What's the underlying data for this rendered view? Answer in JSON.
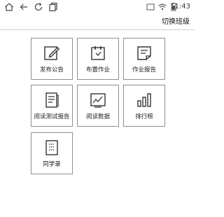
{
  "status_bar": {
    "time": "11:43",
    "icons": [
      "home-icon",
      "back-icon",
      "refresh-icon",
      "window-icon",
      "screen-icon",
      "wifi-icon",
      "battery-icon"
    ]
  },
  "header": {
    "switch_class_label": "切换班级"
  },
  "tiles": [
    {
      "label": "发布公告",
      "icon": "edit-note-icon"
    },
    {
      "label": "布置作业",
      "icon": "calendar-icon"
    },
    {
      "label": "作业报告",
      "icon": "report-doc-icon"
    },
    {
      "label": "阅读测试报告",
      "icon": "test-report-icon"
    },
    {
      "label": "阅读数据",
      "icon": "line-chart-icon"
    },
    {
      "label": "排行榜",
      "icon": "bar-chart-icon"
    },
    {
      "label": "同学录",
      "icon": "classmates-book-icon"
    }
  ],
  "colors": {
    "background": "#ffffff",
    "tile_border": "#8f8f8f",
    "text": "#222222",
    "divider": "#cfcfcf"
  }
}
